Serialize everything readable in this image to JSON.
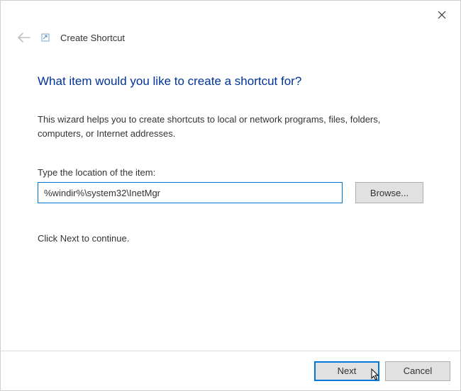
{
  "titlebar": {
    "close_aria": "Close"
  },
  "header": {
    "title": "Create Shortcut"
  },
  "main": {
    "heading": "What item would you like to create a shortcut for?",
    "description": "This wizard helps you to create shortcuts to local or network programs, files, folders, computers, or Internet addresses.",
    "location_label": "Type the location of the item:",
    "location_value": "%windir%\\system32\\InetMgr",
    "browse_label": "Browse...",
    "continue_text": "Click Next to continue."
  },
  "footer": {
    "next_label": "Next",
    "cancel_label": "Cancel"
  }
}
